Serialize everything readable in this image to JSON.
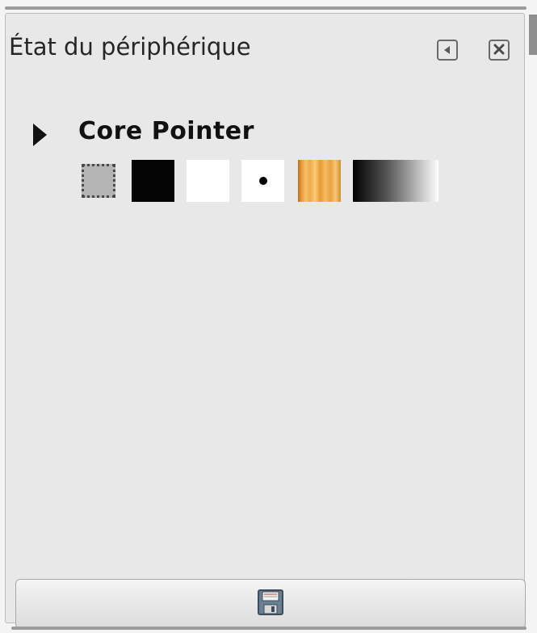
{
  "dock": {
    "title": "État du périphérique",
    "menu_icon": "tab-menu-icon",
    "close_icon": "close-icon"
  },
  "device": {
    "name": "Core Pointer",
    "expander_icon": "expander-triangle-icon",
    "swatches": [
      {
        "name": "selection-icon"
      },
      {
        "name": "foreground-color",
        "color": "#050505"
      },
      {
        "name": "background-color",
        "color": "#ffffff"
      },
      {
        "name": "brush"
      },
      {
        "name": "pattern"
      },
      {
        "name": "gradient"
      }
    ]
  },
  "footer": {
    "save_icon": "save-floppy-icon"
  }
}
